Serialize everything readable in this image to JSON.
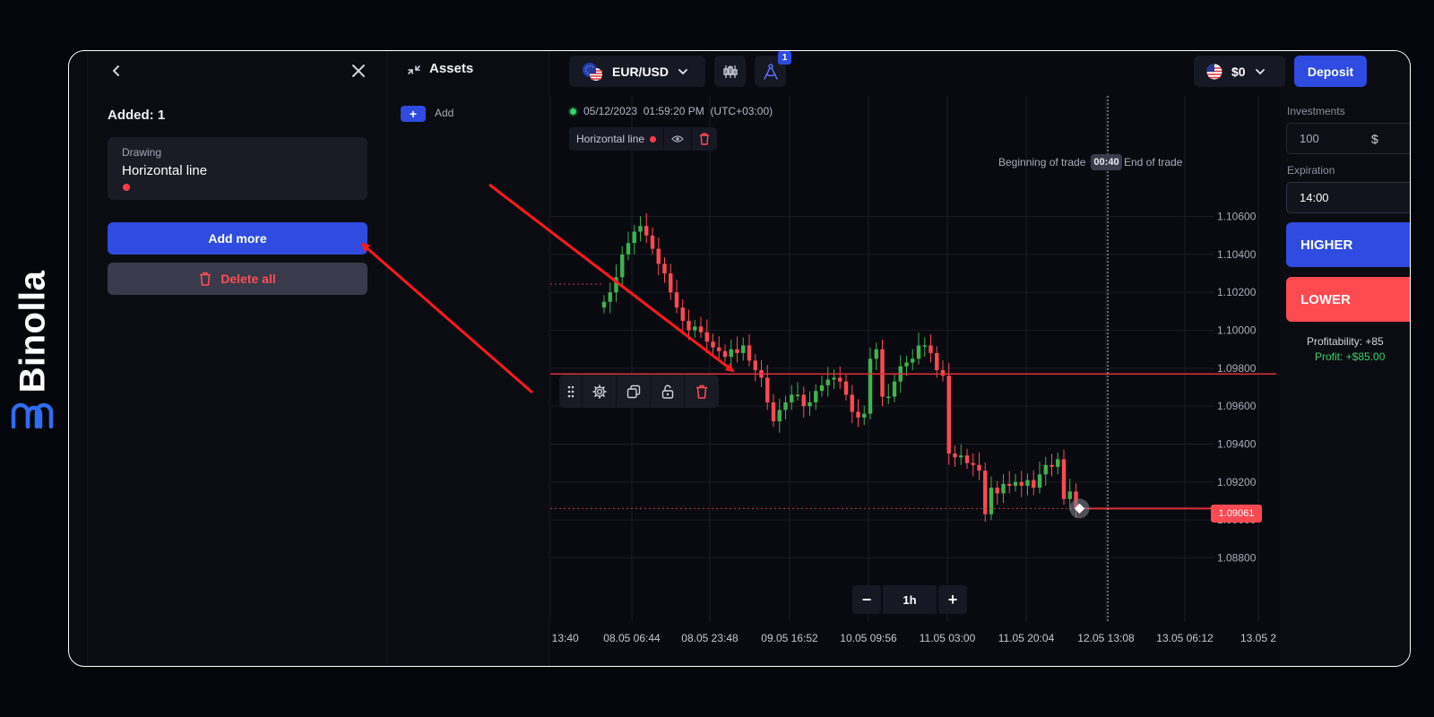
{
  "brand": {
    "name": "Binolla"
  },
  "drawing_panel": {
    "added_label": "Added: 1",
    "card": {
      "type": "Drawing",
      "name": "Horizontal line",
      "color": "#ff3b4c"
    },
    "add_more_label": "Add more",
    "delete_all_label": "Delete all"
  },
  "assets": {
    "title": "Assets",
    "add_label": "Add"
  },
  "header": {
    "pair": "EUR/USD",
    "drawings_count": "1",
    "balance": "$0",
    "deposit_label": "Deposit"
  },
  "chart": {
    "timestamp": "05/12/2023  01:59:20 PM  (UTC+03:00)",
    "chip_label": "Horizontal line",
    "beginning_label": "Beginning of trade",
    "end_label": "End of trade",
    "timer": "00:40",
    "current_price": "1.09061",
    "horizontal_line_price": 1.0977,
    "timeframe": "1h",
    "zoom_minus": "−",
    "zoom_plus": "+"
  },
  "chart_data": {
    "type": "candlestick",
    "y_ticks": [
      "1.10600",
      "1.10400",
      "1.10200",
      "1.10000",
      "1.09800",
      "1.09600",
      "1.09400",
      "1.09200",
      "1.09000",
      "1.08800"
    ],
    "x_ticks": [
      "07.05 13:40",
      "08.05 06:44",
      "08.05 23:48",
      "09.05 16:52",
      "10.05 09:56",
      "11.05 03:00",
      "11.05 20:04",
      "12.05 13:08",
      "13.05 06:12",
      "13.05 2"
    ],
    "ylim": [
      1.087,
      1.1075
    ],
    "closes": [
      1.1015,
      1.102,
      1.1028,
      1.104,
      1.1046,
      1.1052,
      1.1055,
      1.105,
      1.1043,
      1.1035,
      1.103,
      1.102,
      1.1012,
      1.1005,
      1.1,
      1.1002,
      1.0999,
      1.0994,
      1.0991,
      1.0989,
      1.0986,
      1.099,
      1.0988,
      1.0992,
      1.0984,
      1.0979,
      1.0975,
      1.0962,
      1.0952,
      1.0958,
      1.0962,
      1.0966,
      1.0966,
      1.096,
      1.0962,
      1.0968,
      1.0971,
      1.0974,
      1.0975,
      1.0973,
      1.0966,
      1.0957,
      1.0954,
      1.0956,
      1.0985,
      1.099,
      1.0965,
      1.0965,
      1.0973,
      1.0981,
      1.0983,
      1.0985,
      1.0992,
      1.0992,
      1.0988,
      1.0979,
      1.0976,
      1.0935,
      1.0933,
      1.0934,
      1.093,
      1.0929,
      1.0926,
      1.0903,
      1.0917,
      1.0914,
      1.0919,
      1.0918,
      1.092,
      1.0918,
      1.0921,
      1.0917,
      1.0924,
      1.0929,
      1.0928,
      1.0932,
      1.0911,
      1.0915,
      1.0906
    ]
  },
  "trade_panel": {
    "investments_label": "Investments",
    "investment_value": "100",
    "currency": "$",
    "expiration_label": "Expiration",
    "expiration_value": "14:00",
    "higher_label": "HIGHER",
    "lower_label": "LOWER",
    "profitability": "Profitability: +85",
    "profit": "Profit: +$85.00"
  },
  "colors": {
    "accent": "#2f4be0",
    "up": "#3fb34f",
    "down": "#ff4a52",
    "line": "#e03038",
    "annotation_arrow": "#ff1a1a"
  }
}
